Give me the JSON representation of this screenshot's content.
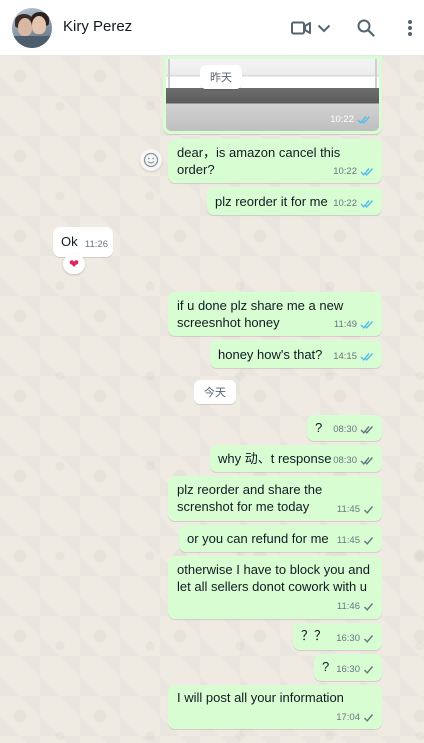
{
  "header": {
    "contact_name": "Kiry Perez",
    "icons": [
      "video-call-icon",
      "chevron-down-icon",
      "search-icon",
      "more-options-icon"
    ]
  },
  "colors": {
    "outgoing_bubble": "#d9fdd3",
    "incoming_bubble": "#ffffff",
    "read_tick": "#53bdeb",
    "delivered_tick": "#667781",
    "chat_background": "#efeae2"
  },
  "date_separators": {
    "yesterday": "昨天",
    "today": "今天"
  },
  "messages": [
    {
      "id": "m0",
      "direction": "out",
      "type": "image",
      "time": "10:22",
      "status": "read"
    },
    {
      "id": "m1",
      "direction": "out",
      "text": "dear，is amazon cancel this\norder?",
      "time": "10:22",
      "status": "read"
    },
    {
      "id": "m2",
      "direction": "out",
      "text": "plz reorder it for me",
      "time": "10:22",
      "status": "read"
    },
    {
      "id": "m3",
      "direction": "in",
      "text": "Ok",
      "time": "11:26",
      "reaction": "❤"
    },
    {
      "id": "m4",
      "direction": "out",
      "text": "if u done plz share me a new\nscreesnhot honey",
      "time": "11:49",
      "status": "read"
    },
    {
      "id": "m5",
      "direction": "out",
      "text": "honey how's that?",
      "time": "14:15",
      "status": "read"
    },
    {
      "id": "m6",
      "direction": "out",
      "text": "?",
      "time": "08:30",
      "status": "delivered"
    },
    {
      "id": "m7",
      "direction": "out",
      "text": "why 动、t response",
      "time": "08:30",
      "status": "delivered"
    },
    {
      "id": "m8",
      "direction": "out",
      "text": "plz reorder and share the\nscrenshot for me today",
      "time": "11:45",
      "status": "sent"
    },
    {
      "id": "m9",
      "direction": "out",
      "text": "or you can refund for me",
      "time": "11:45",
      "status": "sent"
    },
    {
      "id": "m10",
      "direction": "out",
      "text": "otherwise I have to block you and\nlet all sellers donot cowork with u",
      "time": "11:46",
      "status": "sent"
    },
    {
      "id": "m11",
      "direction": "out",
      "text": "？？",
      "time": "16:30",
      "status": "sent"
    },
    {
      "id": "m12",
      "direction": "out",
      "text": "?",
      "time": "16:30",
      "status": "sent"
    },
    {
      "id": "m13",
      "direction": "out",
      "text": "I will post all your information",
      "time": "17:04",
      "status": "sent"
    }
  ]
}
